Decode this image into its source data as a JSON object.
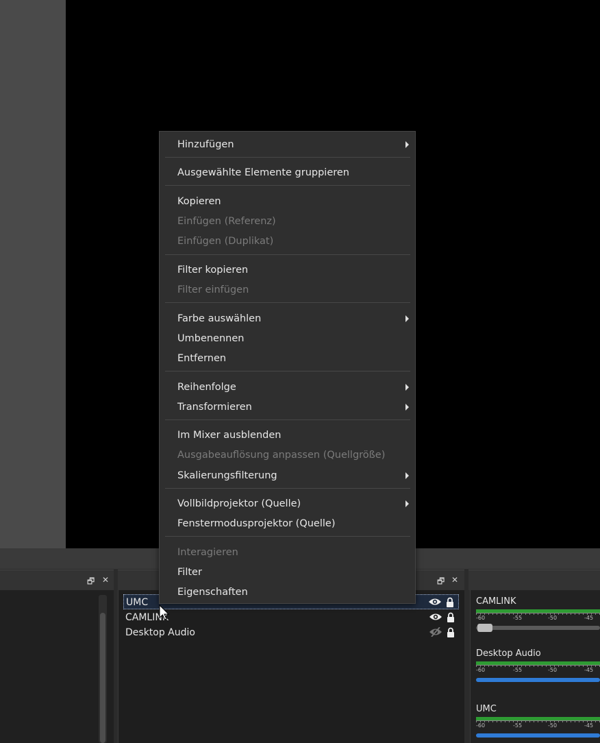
{
  "context_menu": {
    "items": [
      {
        "label": "Hinzufügen",
        "submenu": true,
        "enabled": true
      },
      {
        "label": "Ausgewählte Elemente gruppieren",
        "submenu": false,
        "enabled": true
      },
      {
        "label": "Kopieren",
        "submenu": false,
        "enabled": true
      },
      {
        "label": "Einfügen (Referenz)",
        "submenu": false,
        "enabled": false
      },
      {
        "label": "Einfügen (Duplikat)",
        "submenu": false,
        "enabled": false
      },
      {
        "label": "Filter kopieren",
        "submenu": false,
        "enabled": true
      },
      {
        "label": "Filter einfügen",
        "submenu": false,
        "enabled": false
      },
      {
        "label": "Farbe auswählen",
        "submenu": true,
        "enabled": true
      },
      {
        "label": "Umbenennen",
        "submenu": false,
        "enabled": true
      },
      {
        "label": "Entfernen",
        "submenu": false,
        "enabled": true
      },
      {
        "label": "Reihenfolge",
        "submenu": true,
        "enabled": true
      },
      {
        "label": "Transformieren",
        "submenu": true,
        "enabled": true
      },
      {
        "label": "Im Mixer ausblenden",
        "submenu": false,
        "enabled": true
      },
      {
        "label": "Ausgabeauflösung anpassen (Quellgröße)",
        "submenu": false,
        "enabled": false
      },
      {
        "label": "Skalierungsfilterung",
        "submenu": true,
        "enabled": true
      },
      {
        "label": "Vollbildprojektor (Quelle)",
        "submenu": true,
        "enabled": true
      },
      {
        "label": "Fenstermodusprojektor (Quelle)",
        "submenu": false,
        "enabled": true
      },
      {
        "label": "Interagieren",
        "submenu": false,
        "enabled": false
      },
      {
        "label": "Filter",
        "submenu": false,
        "enabled": true
      },
      {
        "label": "Eigenschaften",
        "submenu": false,
        "enabled": true
      }
    ]
  },
  "sources": [
    {
      "name": "UMC",
      "visible": true,
      "locked": true,
      "selected": true
    },
    {
      "name": "CAMLINK",
      "visible": true,
      "locked": true,
      "selected": false
    },
    {
      "name": "Desktop Audio",
      "visible": false,
      "locked": true,
      "selected": false
    }
  ],
  "mixer": {
    "tick_labels": [
      "-60",
      "-55",
      "-50",
      "-45"
    ],
    "channels": [
      {
        "name": "CAMLINK"
      },
      {
        "name": "Desktop Audio"
      },
      {
        "name": "UMC"
      }
    ]
  },
  "dock_controls": {
    "float": "🗗",
    "close": "✕"
  },
  "colors": {
    "accent_blue": "#2f7bd6",
    "meter_green": "#2e9b33"
  }
}
